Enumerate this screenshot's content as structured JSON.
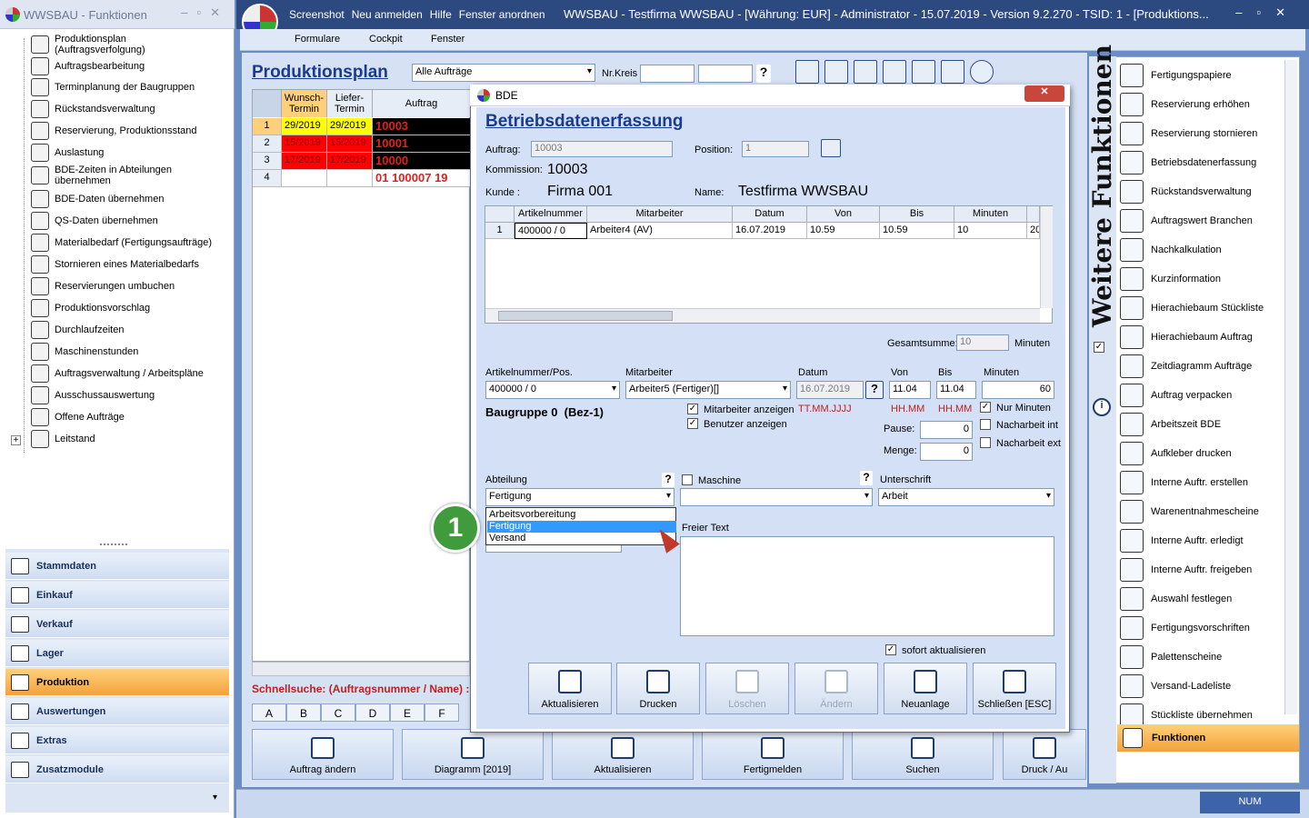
{
  "left_window": {
    "title": "WWSBAU - Funktionen",
    "tree_items": [
      {
        "label": "Produktionsplan\n(Auftragsverfolgung)",
        "icon": "production-plan-icon"
      },
      {
        "label": "Auftragsbearbeitung",
        "icon": "order-edit-icon"
      },
      {
        "label": "Terminplanung der Baugruppen",
        "icon": "schedule-icon"
      },
      {
        "label": "Rückstandsverwaltung",
        "icon": "backlog-icon"
      },
      {
        "label": "Reservierung, Produktionsstand",
        "icon": "reservation-icon"
      },
      {
        "label": "Auslastung",
        "icon": "load-chart-icon"
      },
      {
        "label": "BDE-Zeiten in Abteilungen\nübernehmen",
        "icon": "bde-times-icon"
      },
      {
        "label": "BDE-Daten übernehmen",
        "icon": "bde-data-icon"
      },
      {
        "label": "QS-Daten übernehmen",
        "icon": "qs-data-icon"
      },
      {
        "label": "Materialbedarf (Fertigungsaufträge)",
        "icon": "material-icon"
      },
      {
        "label": "Stornieren eines Materialbedarfs",
        "icon": "cancel-material-icon"
      },
      {
        "label": "Reservierungen umbuchen",
        "icon": "rebook-icon"
      },
      {
        "label": "Produktionsvorschlag",
        "icon": "proposal-icon"
      },
      {
        "label": "Durchlaufzeiten",
        "icon": "hourglass-icon"
      },
      {
        "label": "Maschinenstunden",
        "icon": "machine-hours-icon"
      },
      {
        "label": "Auftragsverwaltung / Arbeitspläne",
        "icon": "workplan-icon"
      },
      {
        "label": "Ausschussauswertung",
        "icon": "trash-icon"
      },
      {
        "label": "Offene Aufträge",
        "icon": "open-orders-icon"
      },
      {
        "label": "Leitstand",
        "icon": "control-icon"
      }
    ],
    "nav_buttons": [
      {
        "label": "Stammdaten",
        "active": false
      },
      {
        "label": "Einkauf",
        "active": false
      },
      {
        "label": "Verkauf",
        "active": false
      },
      {
        "label": "Lager",
        "active": false
      },
      {
        "label": "Produktion",
        "active": true
      },
      {
        "label": "Auswertungen",
        "active": false
      },
      {
        "label": "Extras",
        "active": false
      },
      {
        "label": "Zusatzmodule",
        "active": false
      }
    ]
  },
  "main_window": {
    "toolbar_items": [
      "Screenshot",
      "Neu anmelden",
      "Hilfe",
      "Fenster anordnen"
    ],
    "title": "WWSBAU - Testfirma WWSBAU - [Währung: EUR] - Administrator - 15.07.2019 - Version 9.2.270 - TSID: 1 - [Produktions...",
    "menu": [
      "Formulare",
      "Cockpit",
      "Fenster"
    ]
  },
  "produktionsplan": {
    "title": "Produktionsplan",
    "filter_value": "Alle Aufträge",
    "nrkreis_label": "Nr.Kreis",
    "columns": [
      "Wunsch-\nTermin",
      "Liefer-\nTermin",
      "Auftrag"
    ],
    "rows": [
      {
        "n": "1",
        "wunsch": "29/2019",
        "liefer": "29/2019",
        "auftrag": "10003",
        "color": "#ffff00"
      },
      {
        "n": "2",
        "wunsch": "15/2019",
        "liefer": "15/2019",
        "auftrag": "10001",
        "color": "#ff0000"
      },
      {
        "n": "3",
        "wunsch": "17/2019",
        "liefer": "17/2019",
        "auftrag": "10000",
        "color": "#ff0000"
      },
      {
        "n": "4",
        "wunsch": "",
        "liefer": "",
        "auftrag": "01 100007 19",
        "color": "#ffffff"
      }
    ],
    "schnellsuche": "Schnellsuche: (Auftragsnummer / Name) :",
    "letters": [
      "A",
      "B",
      "C",
      "D",
      "E",
      "F"
    ],
    "bottom_buttons": [
      "Auftrag ändern",
      "Diagramm [2019]",
      "Aktualisieren",
      "Fertigmelden",
      "Suchen",
      "Druck / Au"
    ]
  },
  "right_panel": {
    "vertical_title": "Weitere Funktionen",
    "items": [
      "Fertigungspapiere",
      "Reservierung erhöhen",
      "Reservierung stornieren",
      "Betriebsdatenerfassung",
      "Rückstandsverwaltung",
      "Auftragswert Branchen",
      "Nachkalkulation",
      "Kurzinformation",
      "Hierachiebaum Stückliste",
      "Hierachiebaum Auftrag",
      "Zeitdiagramm Aufträge",
      "Auftrag verpacken",
      "Arbeitszeit BDE",
      "Aufkleber drucken",
      "Interne Auftr. erstellen",
      "Warenentnahmescheine",
      "Interne Auftr. erledigt",
      "Interne Auftr. freigeben",
      "Auswahl festlegen",
      "Fertigungsvorschriften",
      "Palettenscheine",
      "Versand-Ladeliste",
      "Stückliste übernehmen"
    ],
    "footer_button": "Funktionen"
  },
  "dialog": {
    "title": "BDE",
    "heading": "Betriebsdatenerfassung",
    "auftrag_label": "Auftrag:",
    "auftrag_value": "10003",
    "position_label": "Position:",
    "position_value": "1",
    "kommission_label": "Kommission:",
    "kommission_value": "10003",
    "kunde_label": "Kunde :",
    "kunde_value": "Firma 001",
    "name_label": "Name:",
    "name_value": "Testfirma WWSBAU",
    "grid_columns": [
      "Artikelnummer",
      "Mitarbeiter",
      "Datum",
      "Von",
      "Bis",
      "Minuten"
    ],
    "grid_rows": [
      {
        "n": "1",
        "artikel": "400000 / 0",
        "mitarbeiter": "Arbeiter4 (AV)",
        "datum": "16.07.2019",
        "von": "10.59",
        "bis": "10.59",
        "minuten": "10",
        "extra": "20"
      }
    ],
    "gesamtsumme_label": "Gesamtsumme:",
    "gesamtsumme_value": "10",
    "minuten_label": "Minuten",
    "form": {
      "artikel_label": "Artikelnummer/Pos.",
      "artikel_value": "400000 / 0",
      "mitarbeiter_label": "Mitarbeiter",
      "mitarbeiter_value": "Arbeiter5 (Fertiger)[]",
      "datum_label": "Datum",
      "datum_value": "16.07.2019",
      "von_label": "Von",
      "von_value": "11.04",
      "bis_label": "Bis",
      "bis_value": "11.04",
      "minuten_label": "Minuten",
      "minuten_value": "60",
      "baugruppe": "Baugruppe 0  (Bez-1)",
      "cb_mitarbeiter": "Mitarbeiter anzeigen",
      "cb_benutzer": "Benutzer anzeigen",
      "date_hint": "TT.MM.JJJJ",
      "hhmm1": "HH.MM",
      "hhmm2": "HH.MM",
      "cb_nur_minuten": "Nur Minuten",
      "cb_nacharbeit_int": "Nacharbeit int",
      "cb_nacharbeit_ext": "Nacharbeit ext",
      "pause_label": "Pause:",
      "pause_value": "0",
      "menge_label": "Menge:",
      "menge_value": "0",
      "abteilung_label": "Abteilung",
      "abteilung_value": "Fertigung",
      "maschine_label": "Maschine",
      "unterschrift_label": "Unterschrift",
      "unterschrift_value": "Arbeit",
      "freitext_label": "Freier Text",
      "sofort_label": "sofort aktualisieren",
      "dropdown_options": [
        "Arbeitsvorbereitung",
        "Fertigung",
        "Versand"
      ],
      "dropdown_selected": 1
    },
    "buttons": [
      {
        "label": "Aktualisieren",
        "enabled": true,
        "icon": "refresh-icon"
      },
      {
        "label": "Drucken",
        "enabled": true,
        "icon": "print-icon"
      },
      {
        "label": "Löschen",
        "enabled": false,
        "icon": "delete-icon"
      },
      {
        "label": "Ändern",
        "enabled": false,
        "icon": "edit-icon"
      },
      {
        "label": "Neuanlage",
        "enabled": true,
        "icon": "new-icon"
      },
      {
        "label": "Schließen [ESC]",
        "enabled": true,
        "icon": "close-icon"
      }
    ]
  },
  "marker": "1",
  "status": {
    "num": "NUM"
  }
}
